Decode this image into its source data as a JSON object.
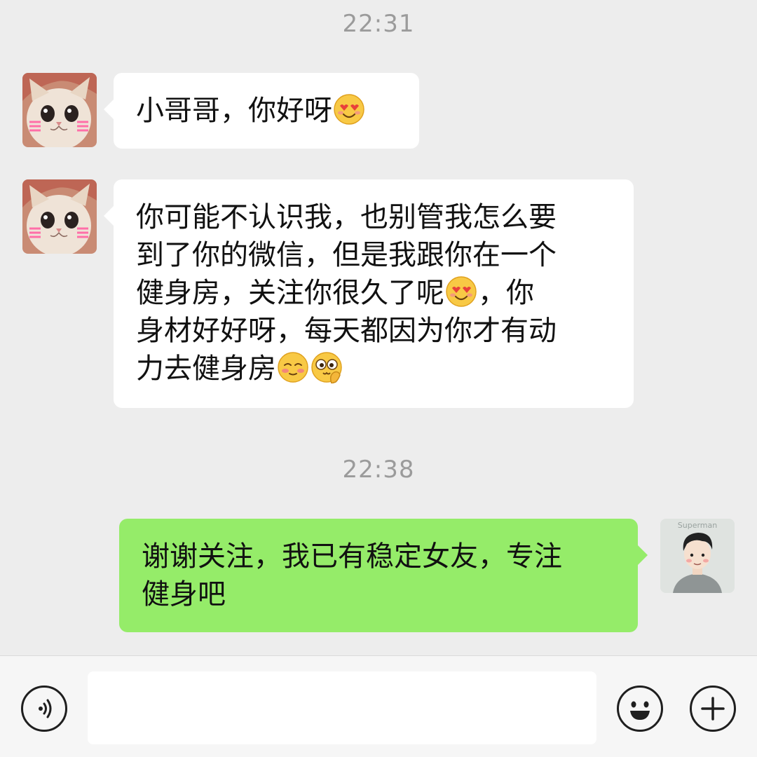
{
  "chat": {
    "timestamps": [
      "22:31",
      "22:38"
    ],
    "messages": [
      {
        "sender": "contact",
        "lines": [
          "小哥哥，你好呀"
        ],
        "trailing_emoji": [
          "heart-eyes-emoji"
        ]
      },
      {
        "sender": "contact",
        "lines": [
          "你可能不认识我，也别管我怎么要",
          "到了你的微信，但是我跟你在一个",
          "健身房，关注你很久了呢",
          "，你",
          "身材好好呀，每天都因为你才有动",
          "力去健身房"
        ],
        "inline_emoji": [
          "heart-eyes-emoji",
          "blushing-emoji",
          "shy-peek-emoji"
        ]
      },
      {
        "sender": "me",
        "lines": [
          "谢谢关注，我已有稳定女友，专注",
          "健身吧"
        ]
      }
    ],
    "my_avatar_text": "Superman"
  },
  "inputbar": {
    "placeholder": "",
    "icons": [
      "voice-icon",
      "emoji-icon",
      "plus-icon"
    ]
  },
  "colors": {
    "background": "#ededed",
    "incoming_bubble": "#ffffff",
    "outgoing_bubble": "#95ec69",
    "timestamp": "#9b9b9b"
  }
}
